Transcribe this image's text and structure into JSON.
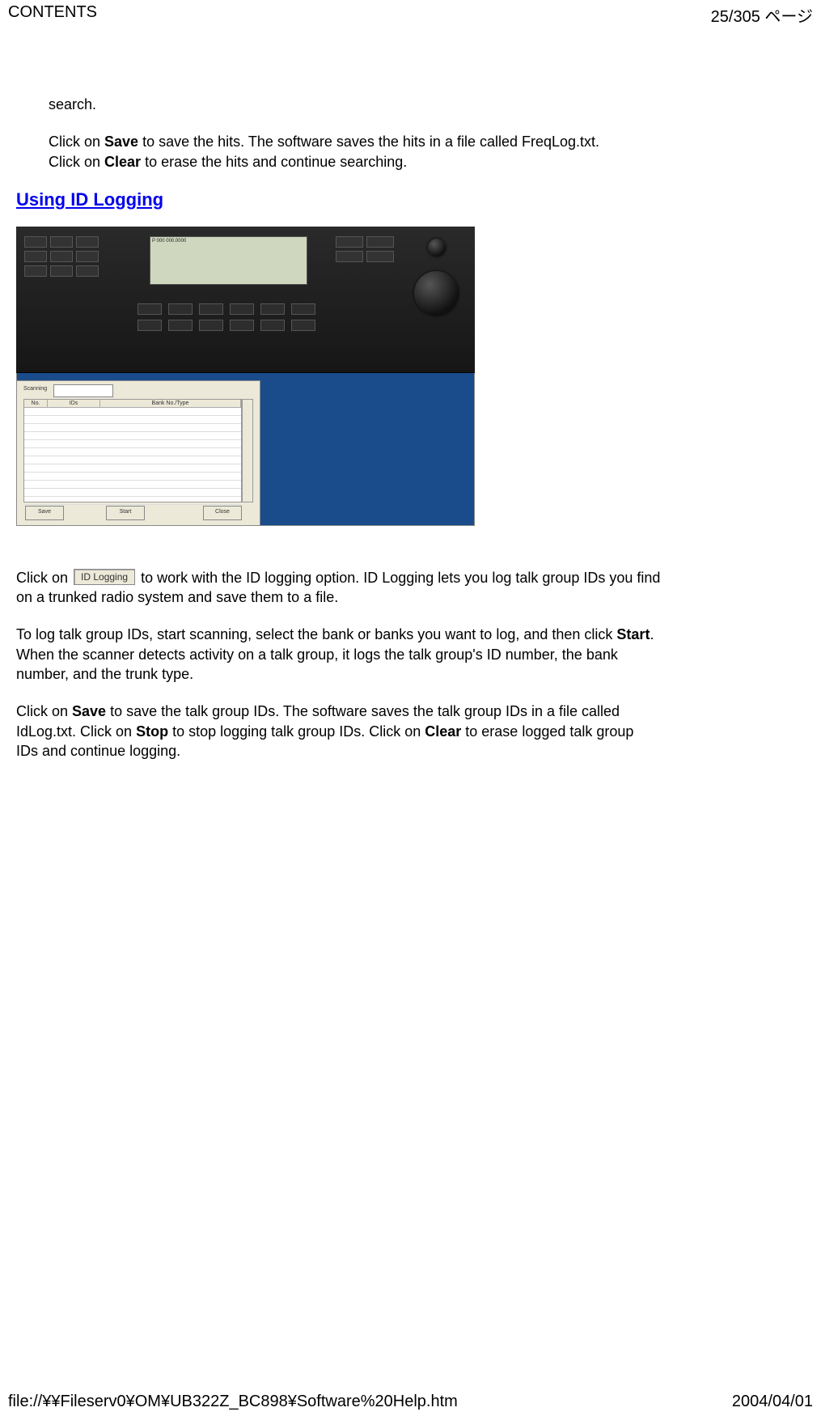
{
  "header": {
    "left": "CONTENTS",
    "right": "25/305 ページ"
  },
  "body": {
    "para1": "search.",
    "para2_pre": "Click on ",
    "para2_bold": "Save",
    "para2_post": " to save the hits.  The software saves the hits in a file called FreqLog.txt.",
    "para3_pre": "Click on ",
    "para3_bold": "Clear",
    "para3_post": " to erase the hits and continue searching.",
    "heading": "Using ID Logging",
    "screenshot": {
      "lcd_line1": "P 000  000.0000",
      "dialog_label": "Scanning",
      "dialog_drop": "",
      "col_no": "No.",
      "col_ids": "IDs",
      "col_bank": "Bank No./Type",
      "btn_save": "Save",
      "btn_start": "Start",
      "btn_close": "Close"
    },
    "para4_pre": "Click on ",
    "para4_btn": "ID Logging",
    "para4_post": " to work with the ID logging option.  ID Logging lets you log talk group IDs you find",
    "para4_line2": "on a trunked radio system and save them to a file.",
    "para5_line1_pre": "To log talk group IDs, start scanning, select the bank or banks you want to log, and then click ",
    "para5_line1_bold": "Start",
    "para5_line1_post": ".",
    "para5_line2": "When the scanner detects activity on a talk group, it logs the talk group's ID number, the bank",
    "para5_line3": "number, and the trunk type.",
    "para6_seg1_pre": "Click on ",
    "para6_seg1_bold": "Save",
    "para6_seg1_post": " to save the talk group IDs.  The software saves the talk group IDs in a file called",
    "para6_seg2_pre": "IdLog.txt. Click on ",
    "para6_seg2_bold": "Stop",
    "para6_seg2_mid": " to stop logging talk group IDs. Click on ",
    "para6_seg2_bold2": "Clear",
    "para6_seg2_post": " to erase logged talk group",
    "para6_seg3": "IDs and continue logging."
  },
  "footer": {
    "left": "file://¥¥Fileserv0¥OM¥UB322Z_BC898¥Software%20Help.htm",
    "right": "2004/04/01"
  }
}
